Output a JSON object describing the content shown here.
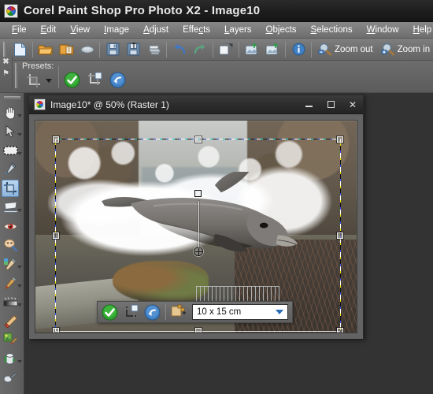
{
  "window": {
    "title": "Corel Paint Shop Pro Photo X2 - Image10",
    "app_icon": "color-wheel-icon"
  },
  "menubar": {
    "items": [
      {
        "label": "File",
        "mnemonic": "F"
      },
      {
        "label": "Edit",
        "mnemonic": "E"
      },
      {
        "label": "View",
        "mnemonic": "V"
      },
      {
        "label": "Image",
        "mnemonic": "I"
      },
      {
        "label": "Adjust",
        "mnemonic": "A"
      },
      {
        "label": "Effects",
        "mnemonic": "c"
      },
      {
        "label": "Layers",
        "mnemonic": "L"
      },
      {
        "label": "Objects",
        "mnemonic": "O"
      },
      {
        "label": "Selections",
        "mnemonic": "S"
      },
      {
        "label": "Window",
        "mnemonic": "W"
      },
      {
        "label": "Help",
        "mnemonic": "H"
      }
    ]
  },
  "toolbar": {
    "buttons": [
      {
        "name": "new-image-icon",
        "tip": "New"
      },
      {
        "name": "open-folder-icon",
        "tip": "Open"
      },
      {
        "name": "browse-folder-icon",
        "tip": "Browse"
      },
      {
        "name": "capture-icon",
        "tip": "Screen Capture"
      },
      {
        "name": "save-icon",
        "tip": "Save"
      },
      {
        "name": "save-as-icon",
        "tip": "Save As"
      },
      {
        "name": "print-icon",
        "tip": "Print"
      },
      {
        "name": "undo-icon",
        "tip": "Undo"
      },
      {
        "name": "redo-icon",
        "tip": "Redo"
      },
      {
        "name": "duplicate-icon",
        "tip": "Duplicate"
      },
      {
        "name": "share-photo-icon",
        "tip": "Share"
      },
      {
        "name": "upload-photo-icon",
        "tip": "Upload"
      },
      {
        "name": "info-icon",
        "tip": "Image Information"
      }
    ],
    "zoom_out_label": "Zoom out",
    "zoom_in_label": "Zoom in"
  },
  "tooloptions": {
    "close_glyph": "✖",
    "pin_glyph": "⚑",
    "presets_label": "Presets:",
    "preset_icon": "crop-preset-icon",
    "actions": [
      {
        "name": "apply-crop-button",
        "icon": "green-check-icon"
      },
      {
        "name": "crop-as-new-image-button",
        "icon": "crop-new-image-icon"
      },
      {
        "name": "reset-crop-button",
        "icon": "blue-undo-icon"
      }
    ]
  },
  "tools": {
    "items": [
      {
        "name": "pan-tool",
        "icon": "hand-icon",
        "flyout": true,
        "active": false
      },
      {
        "name": "pick-tool",
        "icon": "arrow-icon",
        "flyout": true,
        "active": false
      },
      {
        "name": "selection-tool",
        "icon": "marquee-icon",
        "flyout": true,
        "active": false
      },
      {
        "name": "dropper-tool",
        "icon": "eyedropper-icon",
        "flyout": false,
        "active": false
      },
      {
        "name": "crop-tool",
        "icon": "crop-icon",
        "flyout": false,
        "active": true
      },
      {
        "name": "straighten-tool",
        "icon": "straighten-icon",
        "flyout": true,
        "active": false
      },
      {
        "name": "red-eye-tool",
        "icon": "red-eye-icon",
        "flyout": false,
        "active": false
      },
      {
        "name": "makeover-tool",
        "icon": "makeover-icon",
        "flyout": false,
        "active": false
      },
      {
        "name": "clone-brush-tool",
        "icon": "clone-brush-icon",
        "flyout": true,
        "active": false
      },
      {
        "name": "paint-brush-tool",
        "icon": "paintbrush-icon",
        "flyout": true,
        "active": false
      },
      {
        "name": "dodge-burn-tool",
        "icon": "gradient-bar-icon",
        "flyout": true,
        "active": false
      },
      {
        "name": "eraser-tool",
        "icon": "eraser-icon",
        "flyout": false,
        "active": false
      },
      {
        "name": "picture-tube-tool",
        "icon": "picture-tube-icon",
        "flyout": false,
        "active": false
      },
      {
        "name": "flood-fill-tool",
        "icon": "paint-bucket-icon",
        "flyout": true,
        "active": false
      },
      {
        "name": "smudge-tool",
        "icon": "smudge-icon",
        "flyout": false,
        "active": false
      }
    ]
  },
  "document": {
    "caption": "Image10* @  50% (Raster 1)",
    "name": "Image10*",
    "zoom": "50%",
    "layer": "Raster 1",
    "icon": "document-color-wheel-icon",
    "minimize_glyph": "–",
    "maximize_glyph": "□",
    "close_glyph": "✕"
  },
  "crop_toolbar": {
    "apply_icon": "green-check-icon",
    "new_image_icon": "crop-new-image-icon",
    "reset_icon": "blue-undo-icon",
    "snap_icon": "snap-to-layer-icon",
    "preset_value": "10 x 15 cm",
    "preset_options": [
      "10 x 15 cm"
    ]
  },
  "crop_overlay": {
    "rotation_handle": "rotation-handle",
    "pivot": "rotation-pivot",
    "handles": [
      "top-left",
      "top-center",
      "top-right",
      "middle-left",
      "middle-right",
      "bottom-left",
      "bottom-center",
      "bottom-right"
    ]
  },
  "colors": {
    "titlebar": "#1d1d1d",
    "menubar": "#7b7b7b",
    "toolbar": "#6f6f6f",
    "workspace": "#333333",
    "selected_tool": "#a8c8e6",
    "accent_green": "#2aa32a",
    "accent_blue": "#2b6cb8"
  }
}
